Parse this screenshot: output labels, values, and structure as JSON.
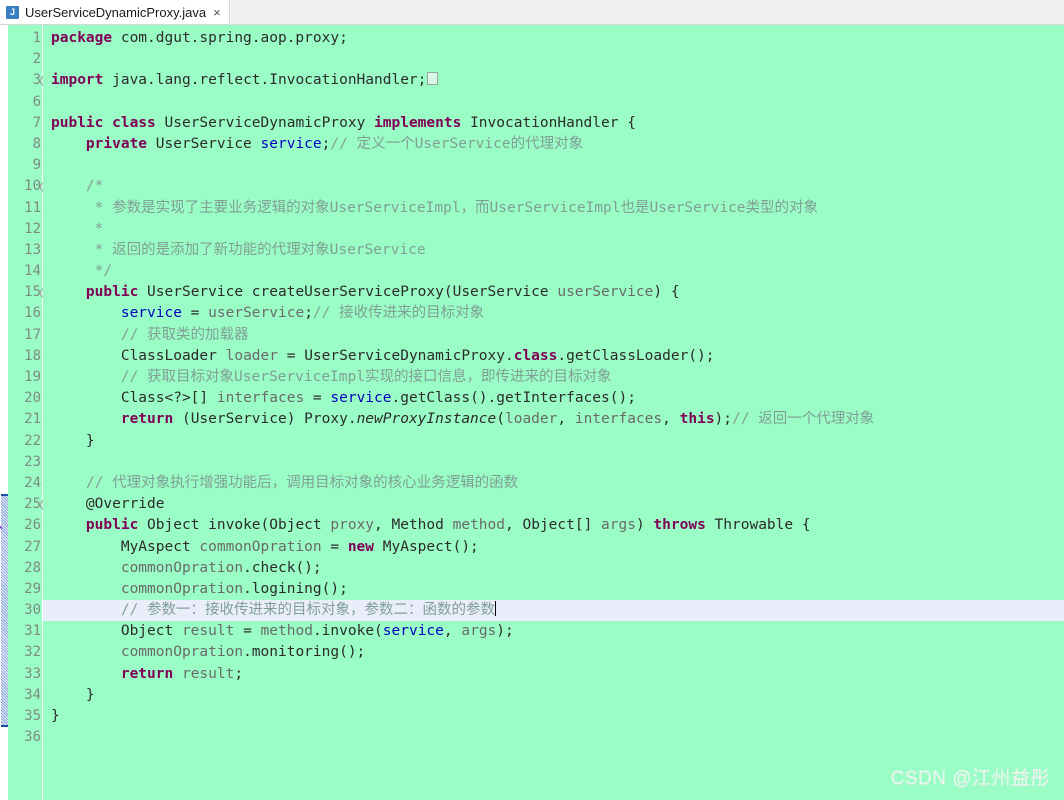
{
  "window": {
    "title": "UserServiceDynamicProxy.java"
  },
  "tab": {
    "icon": "java-file-icon",
    "label": "UserServiceDynamicProxy.java",
    "close_label": "×"
  },
  "editor": {
    "current_line": 30,
    "fold_open_glyph": "−",
    "fold_closed_glyph": "+",
    "change_bar_from_line": 24,
    "change_bar_to_line": 34,
    "colors": {
      "background": "#9bfdc6",
      "current_line": "#eaeefb",
      "keyword": "#7f0055",
      "field": "#0000c0",
      "comment": "#7f9f95",
      "parameter": "#6a6a6a",
      "plain": "#2b2b2b",
      "change_bar": "#1a4fa0"
    },
    "lines": [
      {
        "num": "1",
        "fold": "",
        "marker": false,
        "tokens": [
          {
            "t": "kw",
            "v": "package"
          },
          {
            "t": "pln",
            "v": " com.dgut.spring.aop.proxy;"
          }
        ]
      },
      {
        "num": "2",
        "fold": "",
        "marker": false,
        "tokens": []
      },
      {
        "num": "3",
        "fold": "+",
        "marker": false,
        "tokens": [
          {
            "t": "kw",
            "v": "import"
          },
          {
            "t": "pln",
            "v": " java.lang.reflect.InvocationHandler;"
          },
          {
            "t": "foldbox",
            "v": ""
          }
        ]
      },
      {
        "num": "6",
        "fold": "",
        "marker": false,
        "tokens": []
      },
      {
        "num": "7",
        "fold": "",
        "marker": false,
        "tokens": [
          {
            "t": "kw",
            "v": "public"
          },
          {
            "t": "pln",
            "v": " "
          },
          {
            "t": "kw",
            "v": "class"
          },
          {
            "t": "pln",
            "v": " UserServiceDynamicProxy "
          },
          {
            "t": "kw",
            "v": "implements"
          },
          {
            "t": "pln",
            "v": " InvocationHandler {"
          }
        ]
      },
      {
        "num": "8",
        "fold": "",
        "marker": false,
        "tokens": [
          {
            "t": "pln",
            "v": "    "
          },
          {
            "t": "kw",
            "v": "private"
          },
          {
            "t": "pln",
            "v": " UserService "
          },
          {
            "t": "fld",
            "v": "service"
          },
          {
            "t": "pln",
            "v": ";"
          },
          {
            "t": "cmt",
            "v": "// 定义一个UserService的代理对象"
          }
        ]
      },
      {
        "num": "9",
        "fold": "",
        "marker": false,
        "tokens": []
      },
      {
        "num": "10",
        "fold": "−",
        "marker": false,
        "tokens": [
          {
            "t": "cmt",
            "v": "    /*"
          }
        ]
      },
      {
        "num": "11",
        "fold": "",
        "marker": false,
        "tokens": [
          {
            "t": "cmt",
            "v": "     * 参数是实现了主要业务逻辑的对象UserServiceImpl，而UserServiceImpl也是UserService类型的对象"
          }
        ]
      },
      {
        "num": "12",
        "fold": "",
        "marker": false,
        "tokens": [
          {
            "t": "cmt",
            "v": "     *"
          }
        ]
      },
      {
        "num": "13",
        "fold": "",
        "marker": false,
        "tokens": [
          {
            "t": "cmt",
            "v": "     * 返回的是添加了新功能的代理对象UserService"
          }
        ]
      },
      {
        "num": "14",
        "fold": "",
        "marker": false,
        "tokens": [
          {
            "t": "cmt",
            "v": "     */"
          }
        ]
      },
      {
        "num": "15",
        "fold": "−",
        "marker": false,
        "tokens": [
          {
            "t": "pln",
            "v": "    "
          },
          {
            "t": "kw",
            "v": "public"
          },
          {
            "t": "pln",
            "v": " UserService createUserServiceProxy(UserService "
          },
          {
            "t": "par",
            "v": "userService"
          },
          {
            "t": "pln",
            "v": ") {"
          }
        ]
      },
      {
        "num": "16",
        "fold": "",
        "marker": false,
        "tokens": [
          {
            "t": "pln",
            "v": "        "
          },
          {
            "t": "fld",
            "v": "service"
          },
          {
            "t": "pln",
            "v": " = "
          },
          {
            "t": "par",
            "v": "userService"
          },
          {
            "t": "pln",
            "v": ";"
          },
          {
            "t": "cmt",
            "v": "// 接收传进来的目标对象"
          }
        ]
      },
      {
        "num": "17",
        "fold": "",
        "marker": false,
        "tokens": [
          {
            "t": "cmt",
            "v": "        // 获取类的加载器"
          }
        ]
      },
      {
        "num": "18",
        "fold": "",
        "marker": false,
        "tokens": [
          {
            "t": "pln",
            "v": "        ClassLoader "
          },
          {
            "t": "par",
            "v": "loader"
          },
          {
            "t": "pln",
            "v": " = UserServiceDynamicProxy."
          },
          {
            "t": "kw",
            "v": "class"
          },
          {
            "t": "pln",
            "v": ".getClassLoader();"
          }
        ]
      },
      {
        "num": "19",
        "fold": "",
        "marker": false,
        "tokens": [
          {
            "t": "cmt",
            "v": "        // 获取目标对象UserServiceImpl实现的接口信息，即传进来的目标对象"
          }
        ]
      },
      {
        "num": "20",
        "fold": "",
        "marker": false,
        "tokens": [
          {
            "t": "pln",
            "v": "        Class<?>[] "
          },
          {
            "t": "par",
            "v": "interfaces"
          },
          {
            "t": "pln",
            "v": " = "
          },
          {
            "t": "fld",
            "v": "service"
          },
          {
            "t": "pln",
            "v": ".getClass().getInterfaces();"
          }
        ]
      },
      {
        "num": "21",
        "fold": "",
        "marker": false,
        "tokens": [
          {
            "t": "pln",
            "v": "        "
          },
          {
            "t": "kw",
            "v": "return"
          },
          {
            "t": "pln",
            "v": " (UserService) Proxy."
          },
          {
            "t": "sta",
            "v": "newProxyInstance"
          },
          {
            "t": "pln",
            "v": "("
          },
          {
            "t": "par",
            "v": "loader"
          },
          {
            "t": "pln",
            "v": ", "
          },
          {
            "t": "par",
            "v": "interfaces"
          },
          {
            "t": "pln",
            "v": ", "
          },
          {
            "t": "kw",
            "v": "this"
          },
          {
            "t": "pln",
            "v": ");"
          },
          {
            "t": "cmt",
            "v": "// 返回一个代理对象"
          }
        ]
      },
      {
        "num": "22",
        "fold": "",
        "marker": false,
        "tokens": [
          {
            "t": "pln",
            "v": "    }"
          }
        ]
      },
      {
        "num": "23",
        "fold": "",
        "marker": false,
        "tokens": []
      },
      {
        "num": "24",
        "fold": "",
        "marker": false,
        "tokens": [
          {
            "t": "cmt",
            "v": "    // 代理对象执行增强功能后，调用目标对象的核心业务逻辑的函数"
          }
        ]
      },
      {
        "num": "25",
        "fold": "−",
        "marker": false,
        "tokens": [
          {
            "t": "pln",
            "v": "    @Override"
          }
        ]
      },
      {
        "num": "26",
        "fold": "",
        "marker": true,
        "tokens": [
          {
            "t": "pln",
            "v": "    "
          },
          {
            "t": "kw",
            "v": "public"
          },
          {
            "t": "pln",
            "v": " Object invoke(Object "
          },
          {
            "t": "par",
            "v": "proxy"
          },
          {
            "t": "pln",
            "v": ", Method "
          },
          {
            "t": "par",
            "v": "method"
          },
          {
            "t": "pln",
            "v": ", Object[] "
          },
          {
            "t": "par",
            "v": "args"
          },
          {
            "t": "pln",
            "v": ") "
          },
          {
            "t": "kw",
            "v": "throws"
          },
          {
            "t": "pln",
            "v": " Throwable {"
          }
        ]
      },
      {
        "num": "27",
        "fold": "",
        "marker": false,
        "tokens": [
          {
            "t": "pln",
            "v": "        MyAspect "
          },
          {
            "t": "par",
            "v": "commonOpration"
          },
          {
            "t": "pln",
            "v": " = "
          },
          {
            "t": "kw",
            "v": "new"
          },
          {
            "t": "pln",
            "v": " MyAspect();"
          }
        ]
      },
      {
        "num": "28",
        "fold": "",
        "marker": false,
        "tokens": [
          {
            "t": "pln",
            "v": "        "
          },
          {
            "t": "par",
            "v": "commonOpration"
          },
          {
            "t": "pln",
            "v": ".check();"
          }
        ]
      },
      {
        "num": "29",
        "fold": "",
        "marker": false,
        "tokens": [
          {
            "t": "pln",
            "v": "        "
          },
          {
            "t": "par",
            "v": "commonOpration"
          },
          {
            "t": "pln",
            "v": ".logining();"
          }
        ]
      },
      {
        "num": "30",
        "fold": "",
        "marker": false,
        "current": true,
        "tokens": [
          {
            "t": "cmt",
            "v": "        // 参数一：接收传进来的目标对象，参数二：函数的参数"
          },
          {
            "t": "caret",
            "v": ""
          }
        ]
      },
      {
        "num": "31",
        "fold": "",
        "marker": false,
        "tokens": [
          {
            "t": "pln",
            "v": "        Object "
          },
          {
            "t": "par",
            "v": "result"
          },
          {
            "t": "pln",
            "v": " = "
          },
          {
            "t": "par",
            "v": "method"
          },
          {
            "t": "pln",
            "v": ".invoke("
          },
          {
            "t": "fld",
            "v": "service"
          },
          {
            "t": "pln",
            "v": ", "
          },
          {
            "t": "par",
            "v": "args"
          },
          {
            "t": "pln",
            "v": ");"
          }
        ]
      },
      {
        "num": "32",
        "fold": "",
        "marker": false,
        "tokens": [
          {
            "t": "pln",
            "v": "        "
          },
          {
            "t": "par",
            "v": "commonOpration"
          },
          {
            "t": "pln",
            "v": ".monitoring();"
          }
        ]
      },
      {
        "num": "33",
        "fold": "",
        "marker": false,
        "tokens": [
          {
            "t": "pln",
            "v": "        "
          },
          {
            "t": "kw",
            "v": "return"
          },
          {
            "t": "pln",
            "v": " "
          },
          {
            "t": "par",
            "v": "result"
          },
          {
            "t": "pln",
            "v": ";"
          }
        ]
      },
      {
        "num": "34",
        "fold": "",
        "marker": false,
        "tokens": [
          {
            "t": "pln",
            "v": "    }"
          }
        ]
      },
      {
        "num": "35",
        "fold": "",
        "marker": false,
        "tokens": [
          {
            "t": "pln",
            "v": "}"
          }
        ]
      },
      {
        "num": "36",
        "fold": "",
        "marker": false,
        "tokens": []
      }
    ]
  },
  "watermark": {
    "text": "CSDN @江州益彤"
  }
}
